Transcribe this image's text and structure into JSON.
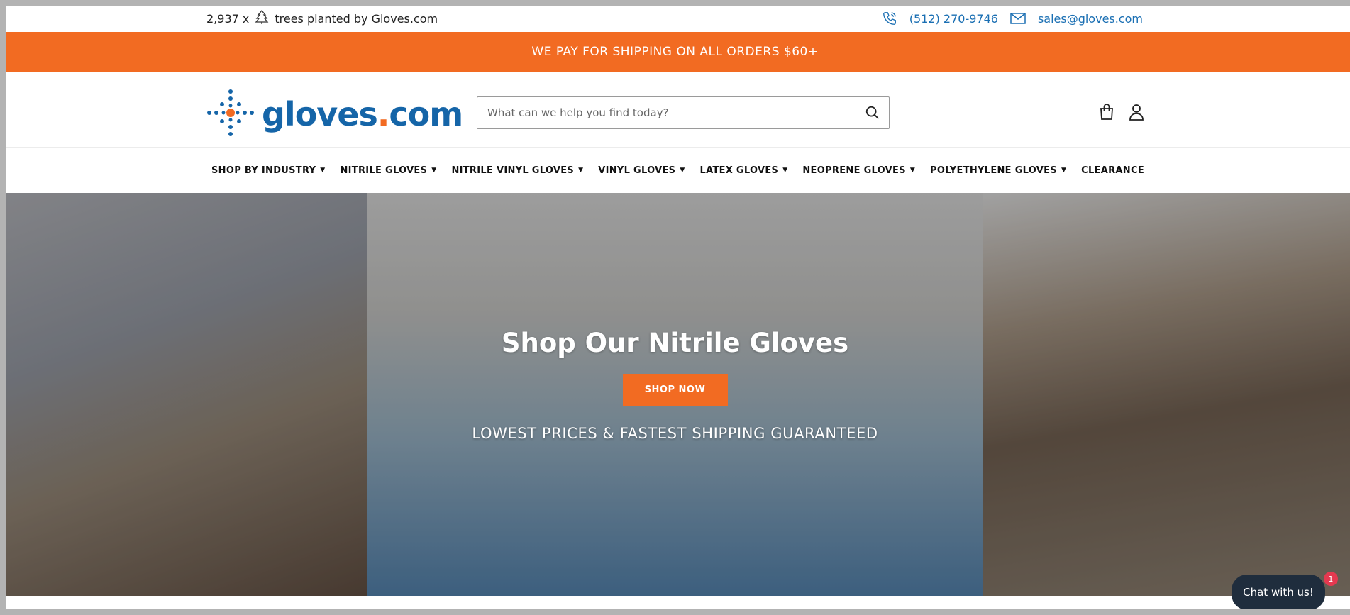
{
  "topbar": {
    "trees_count": "2,937 x",
    "trees_text": "trees planted by Gloves.com",
    "phone": "(512) 270-9746",
    "email": "sales@gloves.com"
  },
  "announcement": {
    "text": "WE PAY FOR SHIPPING ON ALL ORDERS $60+"
  },
  "header": {
    "logo_text_main": "gloves",
    "logo_text_dot": ".",
    "logo_text_tld": "com",
    "search_placeholder": "What can we help you find today?"
  },
  "nav": {
    "items": [
      {
        "label": "SHOP BY INDUSTRY",
        "dropdown": true
      },
      {
        "label": "NITRILE GLOVES",
        "dropdown": true
      },
      {
        "label": "NITRILE VINYL GLOVES",
        "dropdown": true
      },
      {
        "label": "VINYL GLOVES",
        "dropdown": true
      },
      {
        "label": "LATEX GLOVES",
        "dropdown": true
      },
      {
        "label": "NEOPRENE GLOVES",
        "dropdown": true
      },
      {
        "label": "POLYETHYLENE GLOVES",
        "dropdown": true
      },
      {
        "label": "CLEARANCE",
        "dropdown": false
      }
    ]
  },
  "hero": {
    "title": "Shop Our Nitrile Gloves",
    "button_label": "SHOP NOW",
    "subtitle": "LOWEST PRICES & FASTEST SHIPPING GUARANTEED"
  },
  "chat": {
    "label": "Chat with us!",
    "badge": "1"
  },
  "colors": {
    "accent": "#f26b22",
    "brand_blue": "#1565a8",
    "link_blue": "#1a6fb3",
    "chat_bg": "#1f2d3d"
  },
  "icons": [
    "tree-icon",
    "phone-icon",
    "mail-icon",
    "logo-dots-icon",
    "search-icon",
    "cart-icon",
    "account-icon",
    "chevron-down-icon"
  ]
}
